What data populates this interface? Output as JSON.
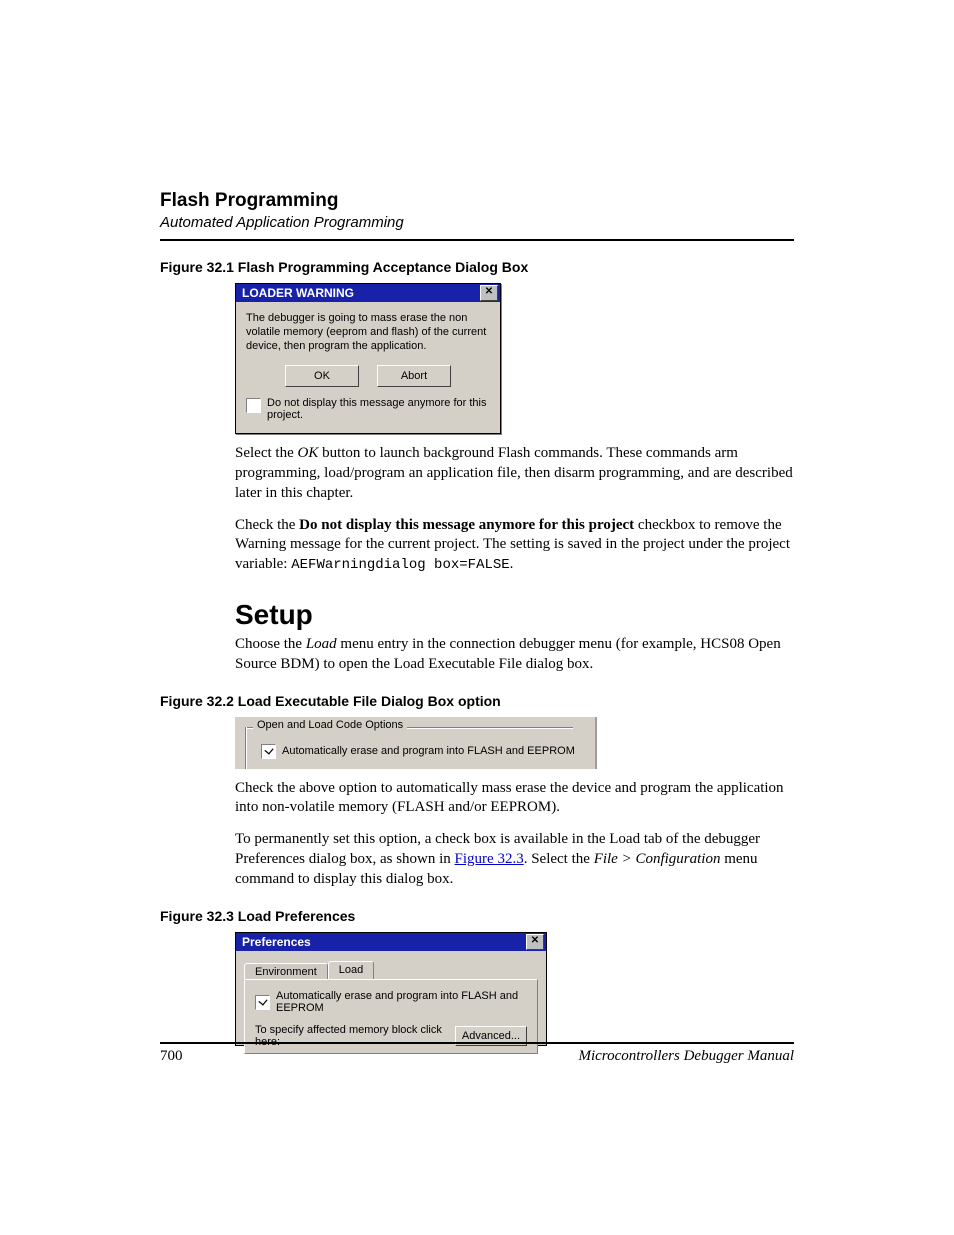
{
  "chapter": {
    "title": "Flash Programming",
    "subtitle": "Automated Application Programming"
  },
  "fig1": {
    "caption": "Figure 32.1  Flash Programming Acceptance Dialog Box",
    "titlebar": "LOADER WARNING",
    "close_glyph": "✕",
    "message": "The debugger is going to mass erase the non volatile memory (eeprom and flash) of the current device, then program the application.",
    "ok_label": "OK",
    "abort_label": "Abort",
    "dont_show_label": "Do not display this message anymore for this project."
  },
  "para1": {
    "pre": "Select the ",
    "ok_em": "OK",
    "post": " button to launch background Flash commands. These commands arm programming, load/program an application file, then disarm programming, and are described later in this chapter."
  },
  "para2": {
    "pre": "Check the ",
    "bold": "Do not display this message anymore for this project",
    "mid": " checkbox to remove the Warning message for the current project. The setting is saved in the project under the project variable: ",
    "code": "AEFWarningdialog box=FALSE",
    "post": "."
  },
  "setup_heading": "Setup",
  "para3": {
    "pre": "Choose the ",
    "load_em": "Load",
    "post": " menu entry in the connection debugger menu (for example, HCS08 Open Source BDM) to open the Load Executable File dialog box."
  },
  "fig2": {
    "caption": "Figure 32.2  Load Executable File Dialog Box option",
    "group_title": "Open and Load Code Options",
    "option_label": "Automatically erase and program into FLASH and EEPROM"
  },
  "para4": "Check the above option to automatically mass erase the device and program the application into non-volatile memory (FLASH and/or EEPROM).",
  "para5": {
    "pre": "To permanently set this option, a check box is available in the Load tab of the debugger Preferences dialog box, as shown in ",
    "link": "Figure 32.3",
    "mid": ". Select the ",
    "menu_em": "File > Configuration",
    "post": " menu command to display this dialog box."
  },
  "fig3": {
    "caption": "Figure 32.3  Load Preferences",
    "titlebar": "Preferences",
    "tab_env": "Environment",
    "tab_load": "Load",
    "auto_label": "Automatically erase and program into FLASH and EEPROM",
    "specify_label": "To specify affected memory block click here:",
    "advanced_label": "Advanced..."
  },
  "footer": {
    "page_number": "700",
    "manual": "Microcontrollers Debugger Manual"
  }
}
